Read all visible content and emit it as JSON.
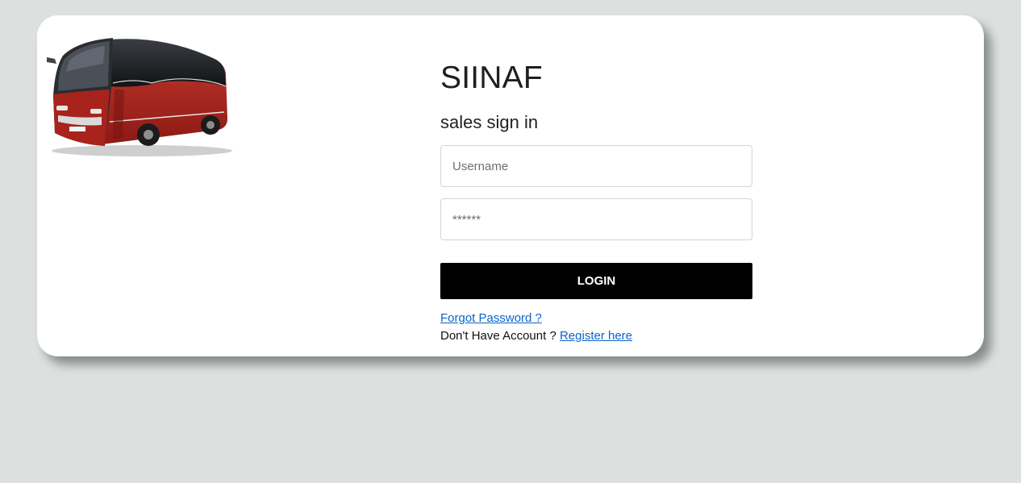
{
  "app": {
    "title": "SIINAF",
    "subtitle": "sales sign in"
  },
  "form": {
    "username_placeholder": "Username",
    "password_placeholder": "******",
    "login_label": "LOGIN",
    "forgot_label": "Forgot Password ?",
    "no_account_text": "Don't Have Account ?",
    "register_label": "Register here"
  },
  "colors": {
    "background": "#dce1e0",
    "card": "#ffffff",
    "button": "#000000",
    "link": "#0a64c8",
    "bus_body": "#a8231c"
  }
}
